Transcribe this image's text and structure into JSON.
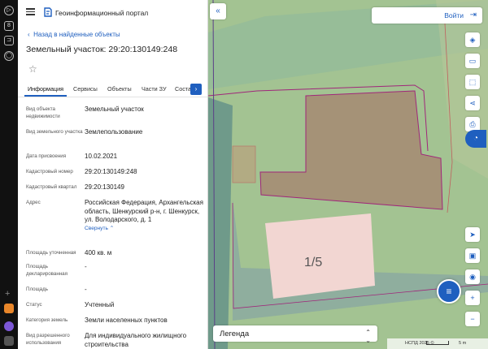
{
  "portal": {
    "title": "Геоинформационный портал"
  },
  "nav": {
    "back_label": "Назад в найденные объекты"
  },
  "object": {
    "title": "Земельный участок: 29:20:130149:248"
  },
  "tabs": [
    {
      "label": "Информация"
    },
    {
      "label": "Сервисы"
    },
    {
      "label": "Объекты"
    },
    {
      "label": "Части ЗУ"
    },
    {
      "label": "Соста"
    }
  ],
  "details": {
    "object_type": {
      "label": "Вид объекта недвижимости",
      "value": "Земельный участок"
    },
    "land_type": {
      "label": "Вид земельного участка",
      "value": "Землепользование"
    },
    "assigned_date": {
      "label": "Дата присвоения",
      "value": "10.02.2021"
    },
    "cadastral_number": {
      "label": "Кадастровый номер",
      "value": "29:20:130149:248"
    },
    "cadastral_quarter": {
      "label": "Кадастровый квартал",
      "value": "29:20:130149"
    },
    "address": {
      "label": "Адрес",
      "value": "Российская Федерация, Архангельская область, Шенкурский р-н, г. Шенкурск, ул. Володарского, д. 1",
      "collapse_label": "Свернуть"
    },
    "area_specified": {
      "label": "Площадь уточненная",
      "value": "400 кв. м"
    },
    "area_declared": {
      "label": "Площадь декларированная",
      "value": "-"
    },
    "area": {
      "label": "Площадь",
      "value": "-"
    },
    "status": {
      "label": "Статус",
      "value": "Учтенный"
    },
    "land_category": {
      "label": "Категория земель",
      "value": "Земли населенных пунктов"
    },
    "permitted_use": {
      "label": "Вид разрешенного использования",
      "value": "Для индивидуального жилищного строительства"
    }
  },
  "header": {
    "login_label": "Войти",
    "login_icon": "login-icon"
  },
  "map": {
    "building_label": "1/5",
    "legend_label": "Легенда",
    "attribution": "НСПД 2025 ©",
    "scale_label": "5 m",
    "colors": {
      "background": "#a3c392",
      "road": "#6f9a8a",
      "parcel_selected": "#a59277",
      "building": "#f2d6d2",
      "boundary": "#a0267a",
      "accent": "#1f5fbf"
    }
  },
  "toolbar": {
    "tools": [
      "layers-icon",
      "ruler-icon",
      "select-area-icon",
      "share-icon",
      "print-icon",
      "chat-bubble-icon"
    ],
    "bottom_tools": [
      "locate-icon",
      "screen-icon",
      "location-pin-icon",
      "zoom-in-icon",
      "zoom-out-icon"
    ],
    "zoom_in": "+",
    "zoom_out": "−"
  }
}
